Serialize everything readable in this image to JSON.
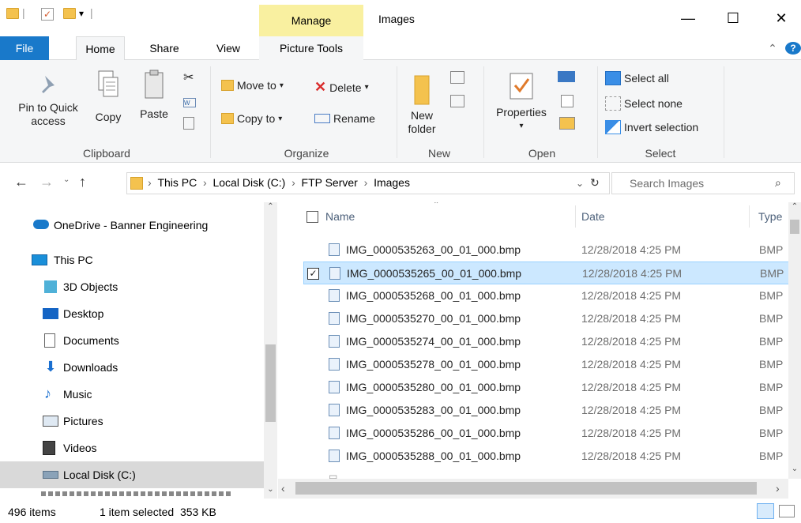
{
  "window": {
    "title": "Images",
    "context_tab": "Manage",
    "controls": {
      "minimize": "—",
      "maximize": "☐",
      "close": "✕"
    }
  },
  "tabs": [
    "File",
    "Home",
    "Share",
    "View",
    "Picture Tools"
  ],
  "ribbon": {
    "clipboard": {
      "pin_label_1": "Pin to Quick",
      "pin_label_2": "access",
      "copy": "Copy",
      "paste": "Paste",
      "group": "Clipboard"
    },
    "organize": {
      "move_to": "Move to",
      "copy_to": "Copy to",
      "delete": "Delete",
      "rename": "Rename",
      "group": "Organize"
    },
    "new": {
      "new_folder_1": "New",
      "new_folder_2": "folder",
      "group": "New"
    },
    "open": {
      "properties": "Properties",
      "group": "Open"
    },
    "select": {
      "select_all": "Select all",
      "select_none": "Select none",
      "invert": "Invert selection",
      "group": "Select"
    }
  },
  "address": {
    "crumbs": [
      "This PC",
      "Local Disk (C:)",
      "FTP Server",
      "Images"
    ],
    "search_placeholder": "Search Images"
  },
  "nav": {
    "items": [
      {
        "label": "OneDrive - Banner Engineering",
        "icon": "cloud-icon"
      },
      {
        "label": "This PC",
        "icon": "computer-icon"
      },
      {
        "label": "3D Objects",
        "icon": "cube-icon"
      },
      {
        "label": "Desktop",
        "icon": "desktop-icon"
      },
      {
        "label": "Documents",
        "icon": "document-icon"
      },
      {
        "label": "Downloads",
        "icon": "download-icon"
      },
      {
        "label": "Music",
        "icon": "music-icon"
      },
      {
        "label": "Pictures",
        "icon": "pictures-icon"
      },
      {
        "label": "Videos",
        "icon": "video-icon"
      },
      {
        "label": "Local Disk (C:)",
        "icon": "drive-icon"
      }
    ]
  },
  "columns": {
    "name": "Name",
    "date": "Date",
    "type": "Type"
  },
  "files": [
    {
      "name": "IMG_0000535263_00_01_000.bmp",
      "date": "12/28/2018 4:25 PM",
      "type": "BMP"
    },
    {
      "name": "IMG_0000535265_00_01_000.bmp",
      "date": "12/28/2018 4:25 PM",
      "type": "BMP"
    },
    {
      "name": "IMG_0000535268_00_01_000.bmp",
      "date": "12/28/2018 4:25 PM",
      "type": "BMP"
    },
    {
      "name": "IMG_0000535270_00_01_000.bmp",
      "date": "12/28/2018 4:25 PM",
      "type": "BMP"
    },
    {
      "name": "IMG_0000535274_00_01_000.bmp",
      "date": "12/28/2018 4:25 PM",
      "type": "BMP"
    },
    {
      "name": "IMG_0000535278_00_01_000.bmp",
      "date": "12/28/2018 4:25 PM",
      "type": "BMP"
    },
    {
      "name": "IMG_0000535280_00_01_000.bmp",
      "date": "12/28/2018 4:25 PM",
      "type": "BMP"
    },
    {
      "name": "IMG_0000535283_00_01_000.bmp",
      "date": "12/28/2018 4:25 PM",
      "type": "BMP"
    },
    {
      "name": "IMG_0000535286_00_01_000.bmp",
      "date": "12/28/2018 4:25 PM",
      "type": "BMP"
    },
    {
      "name": "IMG_0000535288_00_01_000.bmp",
      "date": "12/28/2018 4:25 PM",
      "type": "BMP"
    }
  ],
  "status": {
    "items": "496 items",
    "selected": "1 item selected  353 KB"
  },
  "colors": {
    "accent": "#1979ca",
    "selection": "#cce8ff",
    "manage": "#f9f0a0"
  }
}
